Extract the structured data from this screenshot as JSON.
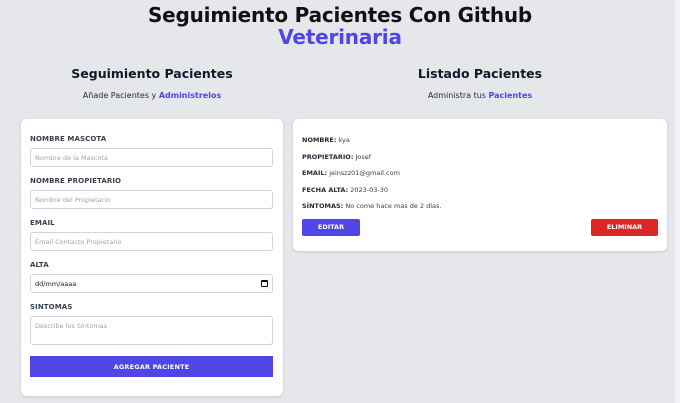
{
  "header": {
    "title": "Seguimiento Pacientes Con Github",
    "title_accent": "Veterinaria"
  },
  "form_section": {
    "title": "Seguimiento Pacientes",
    "subtitle_prefix": "Añade Pacientes y ",
    "subtitle_accent": "Administrelos",
    "fields": {
      "mascota": {
        "label": "NOMBRE MASCOTA",
        "placeholder": "Nombre de la Mascota",
        "value": ""
      },
      "propietario": {
        "label": "NOMBRE PROPIETARIO",
        "placeholder": "Nombre del Propietario",
        "value": ""
      },
      "email": {
        "label": "EMAIL",
        "placeholder": "Email Contacto Propietario",
        "value": ""
      },
      "alta": {
        "label": "ALTA",
        "placeholder": "dd/mm/aaaa",
        "value": ""
      },
      "sintomas": {
        "label": "SINTOMAS",
        "placeholder": "Describe los Síntomas",
        "value": ""
      }
    },
    "submit_label": "AGREGAR PACIENTE"
  },
  "list_section": {
    "title": "Listado Pacientes",
    "subtitle_prefix": "Administra tus ",
    "subtitle_accent": "Pacientes",
    "patients": [
      {
        "nombre_key": "Nombre:",
        "nombre": "kya",
        "propietario_key": "Propietario:",
        "propietario": "Josef",
        "email_key": "Email:",
        "email": "jeinszz01@gmail.com",
        "fecha_key": "Fecha Alta:",
        "fecha": "2023-03-30",
        "sintomas_key": "Síntomas:",
        "sintomas": "No come hace mas de 2 días.",
        "edit_label": "EDITAR",
        "delete_label": "ELIMINAR"
      }
    ]
  },
  "colors": {
    "accent": "#4f46e5",
    "danger": "#dc2626",
    "background": "#e5e7eb"
  }
}
